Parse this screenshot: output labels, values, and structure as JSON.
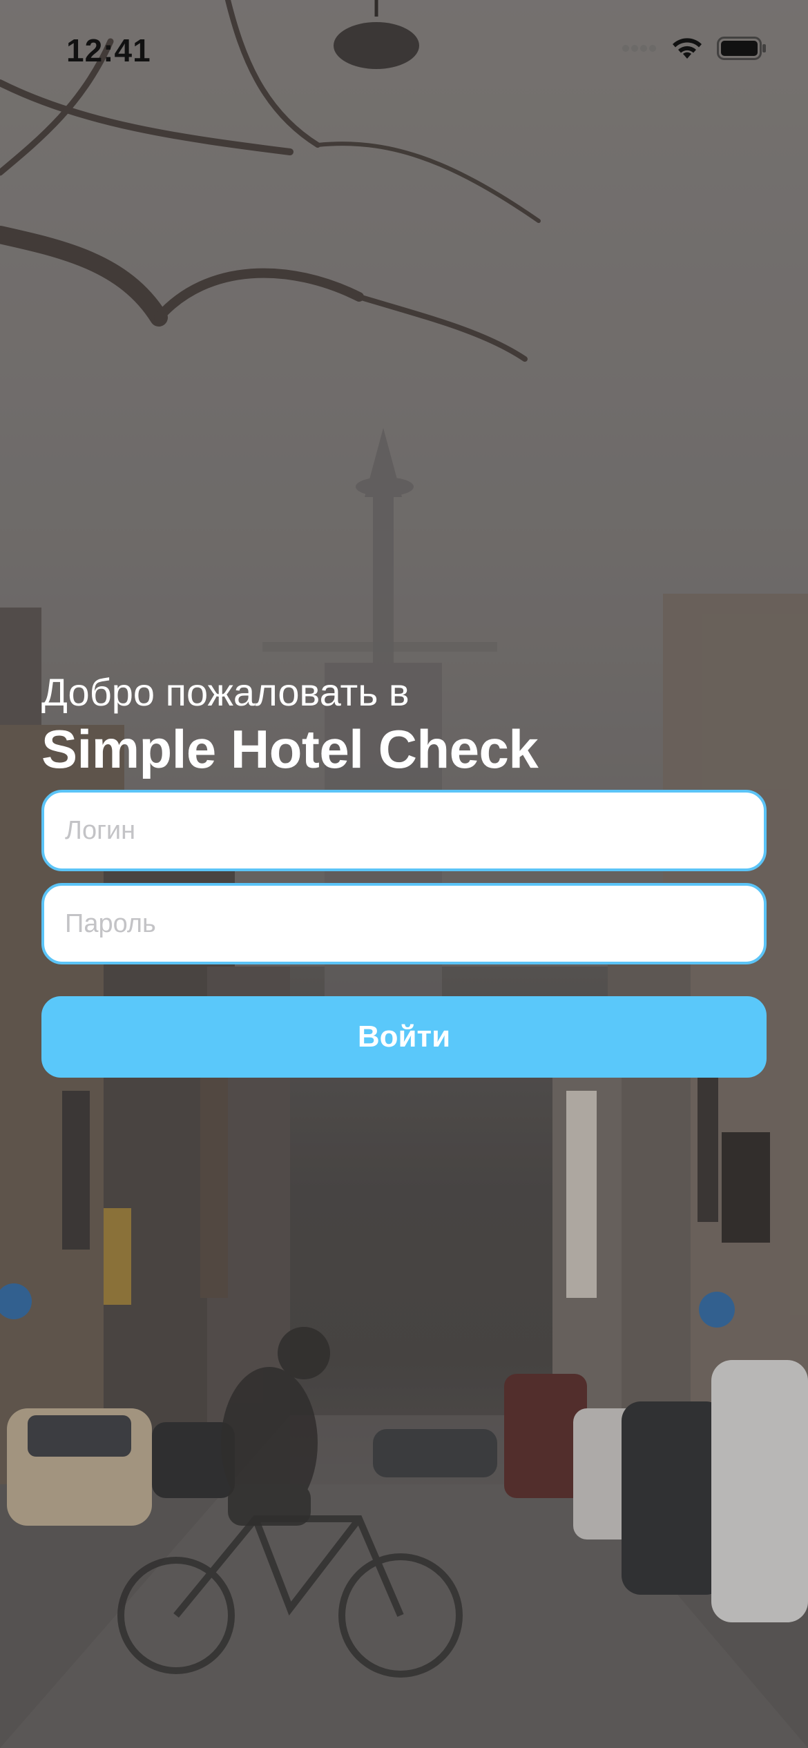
{
  "status_bar": {
    "time": "12:41",
    "icons": [
      "signal-dots-icon",
      "wifi-icon",
      "battery-icon"
    ]
  },
  "welcome": {
    "greeting": "Добро пожаловать в",
    "app_name": "Simple Hotel Check"
  },
  "form": {
    "login_placeholder": "Логин",
    "login_value": "",
    "password_placeholder": "Пароль",
    "password_value": "",
    "submit_label": "Войти"
  },
  "colors": {
    "accent": "#5ac8fa",
    "field_border": "#5bc4f7",
    "placeholder": "#c3c3c6",
    "title_text": "#ffffff"
  }
}
